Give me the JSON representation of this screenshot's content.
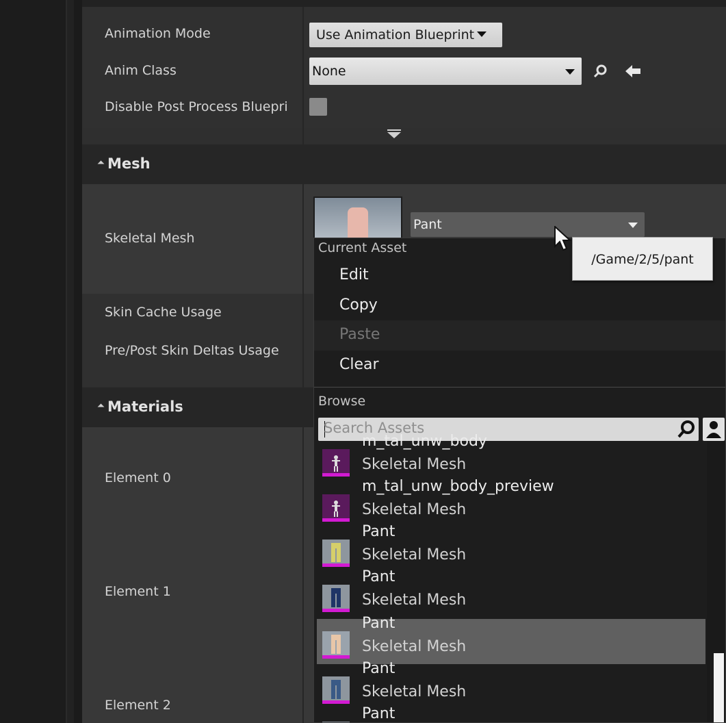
{
  "details": {
    "animation_mode": {
      "label": "Animation Mode",
      "value": "Use Animation Blueprint"
    },
    "anim_class": {
      "label": "Anim Class",
      "value": "None"
    },
    "disable_post_process": {
      "label": "Disable Post Process Bluepri"
    },
    "mesh_section": {
      "title": "Mesh"
    },
    "skeletal_mesh": {
      "label": "Skeletal Mesh",
      "value": "Pant"
    },
    "skin_cache": {
      "label": "Skin Cache Usage"
    },
    "skin_deltas": {
      "label": "Pre/Post Skin Deltas Usage"
    },
    "materials_section": {
      "title": "Materials"
    },
    "elements": [
      "Element 0",
      "Element 1",
      "Element 2"
    ]
  },
  "menu": {
    "current_asset_heading": "Current Asset",
    "items": [
      {
        "label": "Edit",
        "enabled": true
      },
      {
        "label": "Copy",
        "enabled": true
      },
      {
        "label": "Paste",
        "enabled": false
      },
      {
        "label": "Clear",
        "enabled": true
      }
    ],
    "browse_heading": "Browse",
    "search_placeholder": "Search Assets",
    "assets": [
      {
        "name": "m_tal_unw_body",
        "type": "Skeletal Mesh",
        "thumb": "figure-magenta",
        "selected": false
      },
      {
        "name": "m_tal_unw_body_preview",
        "type": "Skeletal Mesh",
        "thumb": "figure-magenta",
        "selected": false
      },
      {
        "name": "Pant",
        "type": "Skeletal Mesh",
        "thumb": "pant-yellow",
        "selected": false
      },
      {
        "name": "Pant",
        "type": "Skeletal Mesh",
        "thumb": "pant-navy",
        "selected": false
      },
      {
        "name": "Pant",
        "type": "Skeletal Mesh",
        "thumb": "pant-skin",
        "selected": true
      },
      {
        "name": "Pant",
        "type": "Skeletal Mesh",
        "thumb": "pant-blue",
        "selected": false
      },
      {
        "name": "Pant",
        "type": "",
        "thumb": "pant-grey",
        "selected": false
      }
    ]
  },
  "tooltip": {
    "path": "/Game/2/5/pant"
  },
  "colors": {
    "menu_bg": "#1d1d1d",
    "selected_row": "#606060",
    "asset_stripe": "#d21ad2"
  }
}
